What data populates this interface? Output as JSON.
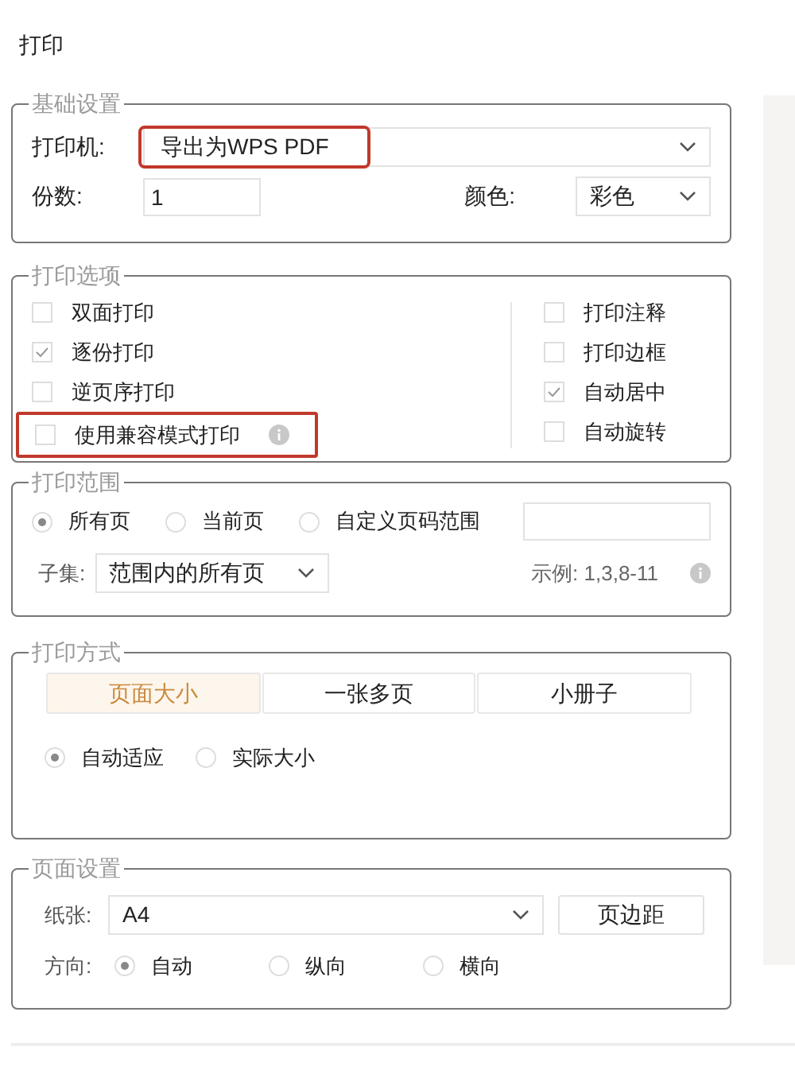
{
  "title": "打印",
  "basic": {
    "legend": "基础设置",
    "printer_label": "打印机:",
    "printer": {
      "value": "导出为WPS PDF",
      "highlighted": true
    },
    "copies_label": "份数:",
    "copies": "1",
    "color_label": "颜色:",
    "color_mode": "彩色"
  },
  "options": {
    "legend": "打印选项",
    "left": [
      {
        "label": "双面打印",
        "checked": false,
        "highlighted": false,
        "info": false
      },
      {
        "label": "逐份打印",
        "checked": true,
        "highlighted": false,
        "info": false
      },
      {
        "label": "逆页序打印",
        "checked": false,
        "highlighted": false,
        "info": false
      },
      {
        "label": "使用兼容模式打印",
        "checked": false,
        "highlighted": true,
        "info": true
      }
    ],
    "right": [
      {
        "label": "打印注释",
        "checked": false
      },
      {
        "label": "打印边框",
        "checked": false
      },
      {
        "label": "自动居中",
        "checked": true
      },
      {
        "label": "自动旋转",
        "checked": false
      }
    ]
  },
  "range": {
    "legend": "打印范围",
    "choices": [
      {
        "label": "所有页",
        "selected": true
      },
      {
        "label": "当前页",
        "selected": false
      },
      {
        "label": "自定义页码范围",
        "selected": false
      }
    ],
    "subset_label": "子集:",
    "subset": "范围内的所有页",
    "example": "示例: 1,3,8-11"
  },
  "method": {
    "legend": "打印方式",
    "tabs": [
      {
        "label": "页面大小",
        "selected": true
      },
      {
        "label": "一张多页",
        "selected": false
      },
      {
        "label": "小册子",
        "selected": false
      }
    ],
    "scaling": [
      {
        "label": "自动适应",
        "selected": true
      },
      {
        "label": "实际大小",
        "selected": false
      }
    ]
  },
  "page": {
    "legend": "页面设置",
    "paper_label": "纸张:",
    "paper": "A4",
    "margins_button": "页边距",
    "orientation_label": "方向:",
    "orientations": [
      {
        "label": "自动",
        "selected": true
      },
      {
        "label": "纵向",
        "selected": false
      },
      {
        "label": "横向",
        "selected": false
      }
    ]
  }
}
